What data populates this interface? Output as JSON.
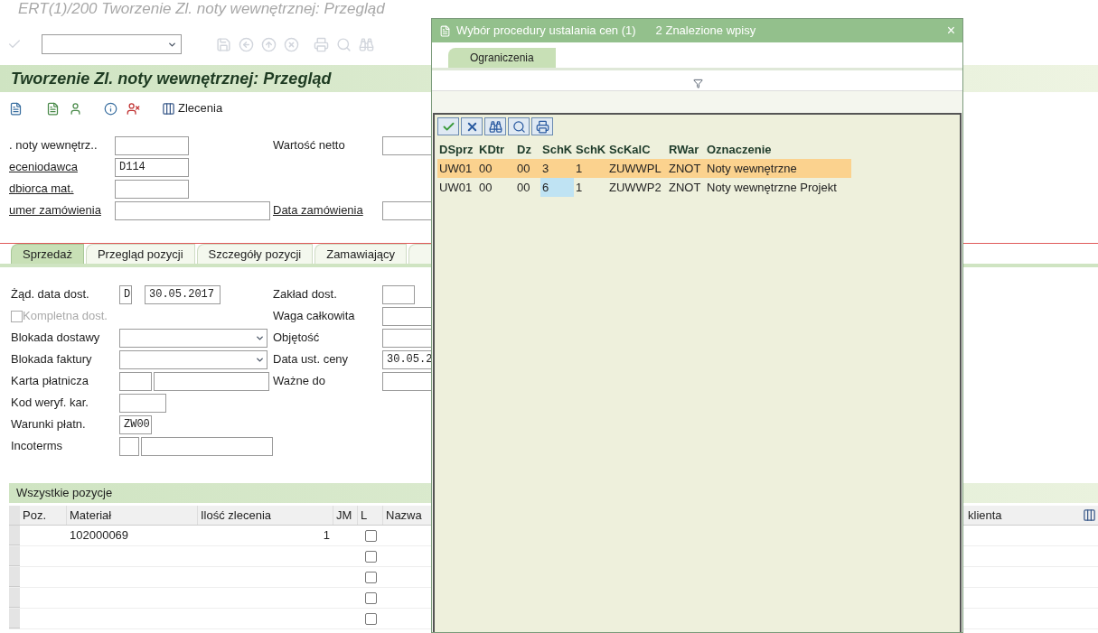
{
  "window": {
    "title": "ERT(1)/200 Tworzenie Zl. noty wewnętrznej: Przegląd"
  },
  "screen_title": "Tworzenie Zl. noty wewnętrznej: Przegląd",
  "app_toolbar": {
    "orders_button": "Zlecenia"
  },
  "header_rows": [
    {
      "left": {
        "label": ". noty wewnętrz..",
        "link": false,
        "kind": "short"
      },
      "right": {
        "label": "Wartość netto",
        "link": false
      }
    },
    {
      "left": {
        "label": "eceniodawca",
        "link": true,
        "kind": "short",
        "value": "D114"
      }
    },
    {
      "left": {
        "label": "dbiorca mat.",
        "link": true,
        "kind": "short"
      }
    },
    {
      "left": {
        "label": "umer zamówienia",
        "link": true,
        "kind": "long"
      },
      "right": {
        "label": "Data zamówienia",
        "link": true
      }
    }
  ],
  "tabs": [
    {
      "label": "Sprzedaż",
      "selected": true
    },
    {
      "label": "Przegląd pozycji",
      "selected": false
    },
    {
      "label": "Szczegóły pozycji",
      "selected": false
    },
    {
      "label": "Zamawiający",
      "selected": false
    },
    {
      "selected": false
    }
  ],
  "sales_rows": [
    {
      "left": {
        "kind": "date",
        "label": "Żąd. data dost.",
        "code": "D",
        "value": "30.05.2017"
      },
      "right": {
        "label": "Zakład dost.",
        "kind": "short"
      }
    },
    {
      "left": {
        "kind": "checkbox",
        "label": "Kompletna dost.",
        "checked": false,
        "disabled": true
      },
      "right": {
        "label": "Waga całkowita",
        "kind": "long"
      }
    },
    {
      "left": {
        "kind": "dropdown",
        "label": "Blokada dostawy"
      },
      "right": {
        "label": "Objętość",
        "kind": "long"
      }
    },
    {
      "left": {
        "kind": "dropdown",
        "label": "Blokada faktury"
      },
      "right": {
        "label": "Data ust. ceny",
        "kind": "long",
        "value": "30.05.2"
      }
    },
    {
      "left": {
        "kind": "pair",
        "label": "Karta płatnicza"
      },
      "right": {
        "label": "Ważne do",
        "kind": "long"
      }
    },
    {
      "left": {
        "kind": "field",
        "label": "Kod weryf. kar."
      }
    },
    {
      "left": {
        "kind": "code",
        "label": "Warunki płatn.",
        "value": "ZW00"
      }
    },
    {
      "left": {
        "kind": "pair_long",
        "label": "Incoterms"
      }
    }
  ],
  "items": {
    "title": "Wszystkie pozycje",
    "columns": [
      "Poz.",
      "Materiał",
      "Ilość zlecenia",
      "JM",
      "L",
      "Nazwa"
    ],
    "right_column": "klienta",
    "rows": [
      {
        "material": "102000069",
        "quantity": "1",
        "checked": false
      },
      {
        "checked": false
      },
      {
        "checked": false
      },
      {
        "checked": false
      },
      {
        "checked": false
      }
    ]
  },
  "dialog": {
    "title": "Wybór procedury ustalania cen (1)",
    "count": "2 Znalezione wpisy",
    "close": "×",
    "tabs": [
      {
        "label": "Ograniczenia",
        "selected": true
      }
    ],
    "columns": [
      "DSprz",
      "KDtr",
      "Dz",
      "SchK",
      "SchK",
      "ScKalC",
      "RWar",
      "Oznaczenie"
    ],
    "rows": [
      {
        "selected": true,
        "cells": [
          {
            "text": "UW01",
            "focused": false
          },
          {
            "text": "00",
            "focused": false
          },
          {
            "text": "00",
            "focused": false
          },
          {
            "text": "3",
            "focused": false
          },
          {
            "text": "1",
            "focused": false
          },
          {
            "text": "ZUWWPL",
            "focused": false
          },
          {
            "text": "ZNOT",
            "focused": false
          },
          {
            "text": "Noty wewnętrzne",
            "focused": false
          }
        ]
      },
      {
        "selected": false,
        "cells": [
          {
            "text": "UW01",
            "focused": false
          },
          {
            "text": "00",
            "focused": false
          },
          {
            "text": "00",
            "focused": false
          },
          {
            "text": "6",
            "focused": true
          },
          {
            "text": "1",
            "focused": false
          },
          {
            "text": "ZUWWP2",
            "focused": false
          },
          {
            "text": "ZNOT",
            "focused": false
          },
          {
            "text": "Noty wewnętrzne Projekt",
            "focused": false
          }
        ]
      }
    ]
  }
}
